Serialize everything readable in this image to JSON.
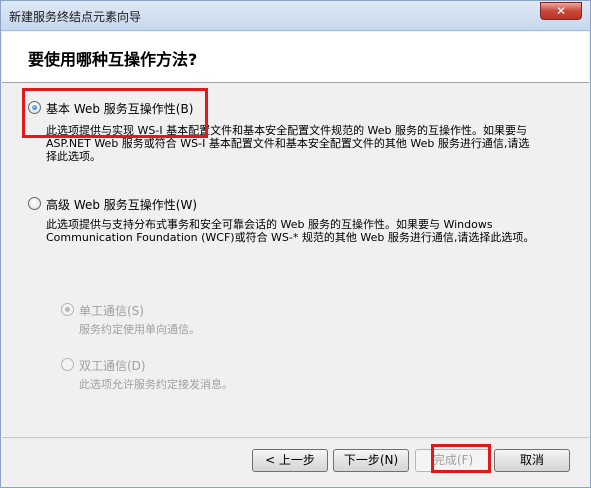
{
  "window": {
    "title": "新建服务终结点元素向导"
  },
  "header": {
    "heading": "要使用哪种互操作方法?"
  },
  "options": {
    "basic": {
      "label": "基本 Web 服务互操作性(B)",
      "desc_lines": [
        "此选项提供与实现 WS-I 基本配置文件和基本安全配置文件规范的 Web 服务的互操作性。如果要与",
        "ASP.NET Web 服务或符合 WS-I 基本配置文件和基本安全配置文件的其他 Web 服务进行通信,请选",
        "择此选项。"
      ]
    },
    "advanced": {
      "label": "高级 Web 服务互操作性(W)",
      "desc_lines": [
        "此选项提供与支持分布式事务和安全可靠会话的 Web 服务的互操作性。如果要与 Windows",
        "Communication Foundation (WCF)或符合 WS-* 规范的其他 Web 服务进行通信,请选择此选项。"
      ]
    },
    "simplex": {
      "label": "单工通信(S)",
      "desc": "服务约定使用单向通信。"
    },
    "duplex": {
      "label": "双工通信(D)",
      "desc": "此选项允许服务约定接发消息。"
    }
  },
  "buttons": {
    "back": "< 上一步",
    "next": "下一步(N)",
    "finish": "完成(F)",
    "cancel": "取消"
  },
  "colors": {
    "highlight": "#e01a1a"
  }
}
